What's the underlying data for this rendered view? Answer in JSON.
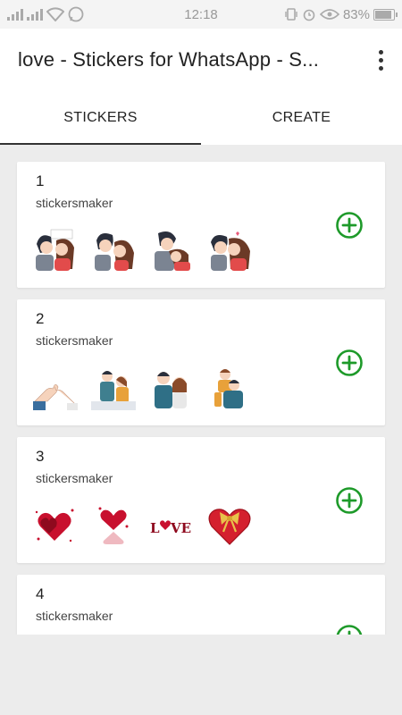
{
  "status_bar": {
    "time": "12:18",
    "battery": "83%"
  },
  "app_bar": {
    "title": "love - Stickers for WhatsApp - S..."
  },
  "tabs": [
    {
      "label": "STICKERS",
      "active": true
    },
    {
      "label": "CREATE",
      "active": false
    }
  ],
  "packs": [
    {
      "number": "1",
      "author": "stickersmaker",
      "stickers": [
        "couple-kiss-sticker",
        "couple-kiss-sticker",
        "couple-kiss-sticker",
        "couple-kiss-sticker"
      ]
    },
    {
      "number": "2",
      "author": "stickersmaker",
      "stickers": [
        "hands-pinky-sticker",
        "couple-sticker",
        "couple-sticker",
        "couple-hug-sticker"
      ]
    },
    {
      "number": "3",
      "author": "stickersmaker",
      "stickers": [
        "hearts-sticker",
        "hearts-reflection-sticker",
        "love-text-sticker",
        "heart-bow-sticker"
      ]
    },
    {
      "number": "4",
      "author": "stickersmaker",
      "stickers": []
    }
  ],
  "colors": {
    "accent_green": "#1e9a2a",
    "background": "#ececec"
  }
}
